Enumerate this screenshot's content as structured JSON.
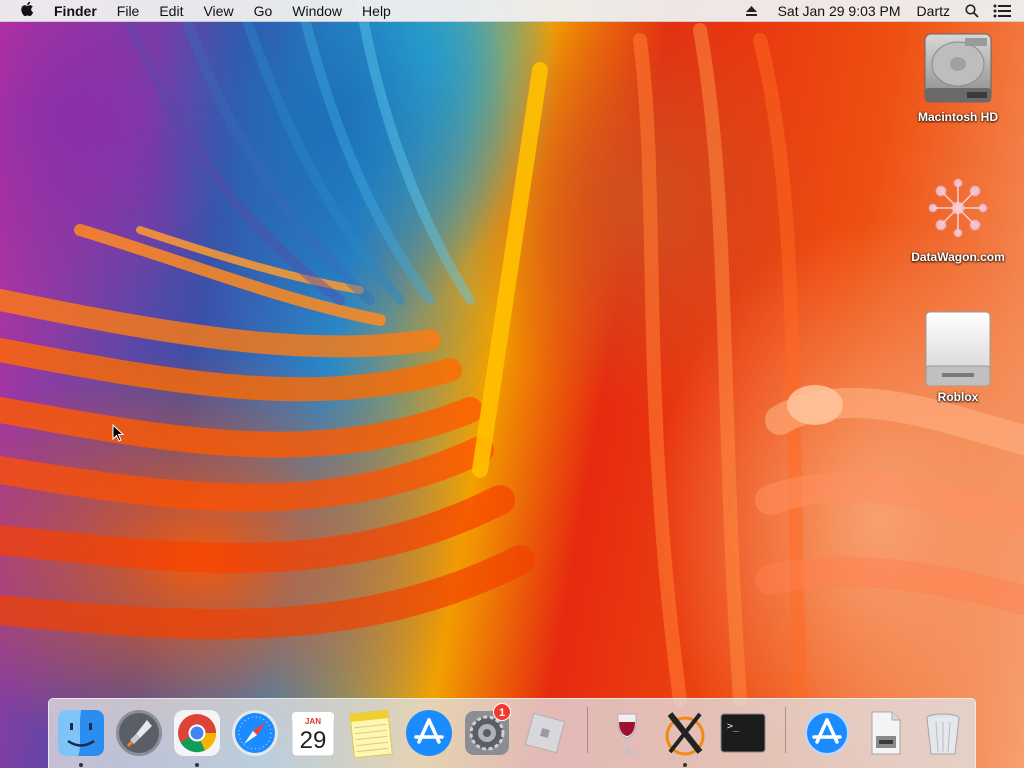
{
  "menubar": {
    "app_name": "Finder",
    "menus": [
      "File",
      "Edit",
      "View",
      "Go",
      "Window",
      "Help"
    ],
    "clock": "Sat Jan 29  9:03 PM",
    "user": "Dartz"
  },
  "desktop": {
    "icons": [
      {
        "label": "Macintosh HD",
        "icon": "hard-drive-icon"
      },
      {
        "label": "DataWagon.com",
        "icon": "datawagon-icon"
      },
      {
        "label": "Roblox",
        "icon": "removable-disk-icon"
      }
    ]
  },
  "dock": {
    "apps": [
      {
        "name": "Finder",
        "icon": "finder-icon",
        "running": true
      },
      {
        "name": "Launchpad",
        "icon": "launchpad-icon",
        "running": false
      },
      {
        "name": "Google Chrome",
        "icon": "chrome-icon",
        "running": true
      },
      {
        "name": "Safari",
        "icon": "safari-icon",
        "running": false
      },
      {
        "name": "Calendar",
        "icon": "calendar-icon",
        "running": false,
        "month": "JAN",
        "day": "29"
      },
      {
        "name": "Notes",
        "icon": "notes-icon",
        "running": false
      },
      {
        "name": "App Store",
        "icon": "app-store-icon",
        "running": false
      },
      {
        "name": "System Preferences",
        "icon": "system-preferences-icon",
        "running": false,
        "badge": "1"
      },
      {
        "name": "Roblox",
        "icon": "roblox-icon",
        "running": false
      },
      {
        "name": "Wine",
        "icon": "wine-icon",
        "running": false
      },
      {
        "name": "X11",
        "icon": "x11-icon",
        "running": true
      },
      {
        "name": "Terminal",
        "icon": "terminal-icon",
        "running": false,
        "prompt": ">_"
      },
      {
        "name": "Applications",
        "icon": "applications-folder-icon",
        "running": false
      },
      {
        "name": "Documents",
        "icon": "document-stack-icon",
        "running": false
      },
      {
        "name": "Trash",
        "icon": "trash-icon",
        "running": false
      }
    ]
  },
  "colors": {
    "menubar_bg": "#eeeeee",
    "badge_red": "#f03a30",
    "accent_blue": "#1a8cff"
  }
}
